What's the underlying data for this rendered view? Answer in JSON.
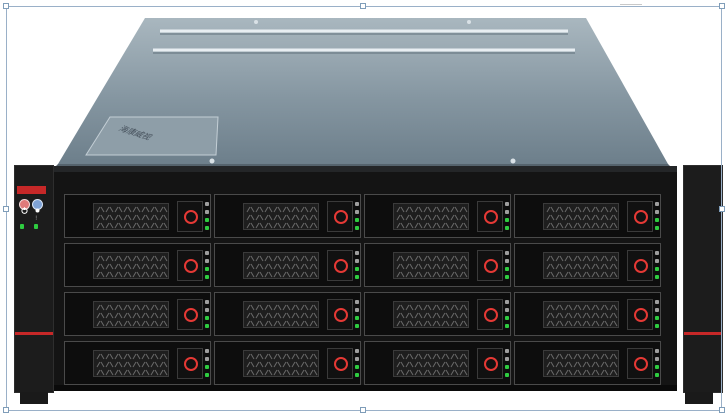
{
  "image": {
    "subject": "server-chassis",
    "lid_label": "海康威视",
    "brand_badge": "",
    "drive_bays": {
      "rows": 4,
      "columns": 4,
      "count": 16
    }
  },
  "front_panel": {
    "power_button": {
      "icon": "power-icon",
      "color": "#e07a7a"
    },
    "id_button": {
      "icon": "id-icon",
      "color": "#7fa3d6"
    },
    "indicators": [
      {
        "label": "",
        "color": "#2ecc40"
      },
      {
        "label": "!",
        "color": "#2ecc40"
      }
    ]
  },
  "colors": {
    "lid": "#8a9ba6",
    "front": "#141414",
    "accent_red": "#c62828",
    "latch_ring": "#e53935",
    "status_led": "#2ecc40"
  },
  "selection": {
    "handles": 8
  }
}
